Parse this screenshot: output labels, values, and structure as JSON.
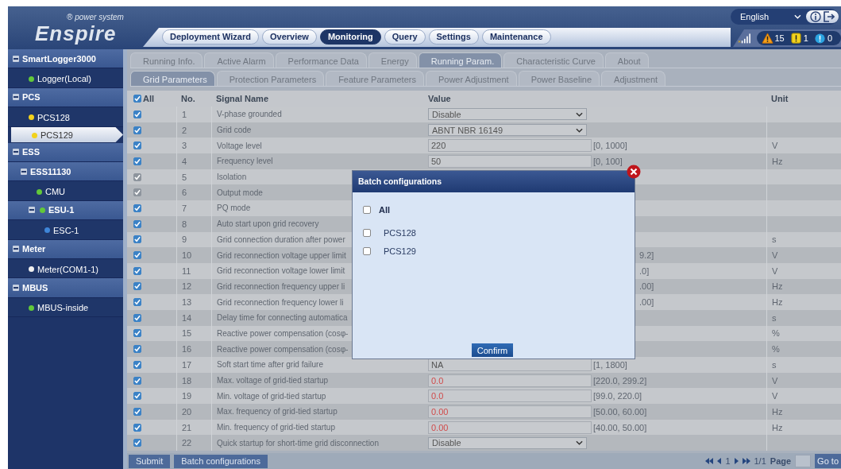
{
  "header": {
    "logo": "Enspire",
    "logo_tagline": "® power system",
    "language": "English",
    "nav": [
      {
        "label": "Deployment Wizard",
        "selected": false
      },
      {
        "label": "Overview",
        "selected": false
      },
      {
        "label": "Monitoring",
        "selected": true
      },
      {
        "label": "Query",
        "selected": false
      },
      {
        "label": "Settings",
        "selected": false
      },
      {
        "label": "Maintenance",
        "selected": false
      }
    ],
    "alarms": [
      {
        "kind": "major",
        "count": "15"
      },
      {
        "kind": "minor",
        "count": "1"
      },
      {
        "kind": "warning",
        "count": "0"
      }
    ]
  },
  "sidebar": {
    "items": [
      {
        "label": "SmartLogger3000",
        "expanded": true,
        "children": [
          {
            "label": "Logger(Local)",
            "color": "#62c83a",
            "selected": false
          }
        ]
      },
      {
        "label": "PCS",
        "expanded": true,
        "children": [
          {
            "label": "PCS128",
            "color": "#f2d21c",
            "selected": false
          },
          {
            "label": "PCS129",
            "color": "#f2d21c",
            "selected": true
          }
        ]
      },
      {
        "label": "ESS",
        "expanded": true,
        "children": [
          {
            "label": "ESS11130",
            "expanded": true,
            "children": [
              {
                "label": "CMU",
                "color": "#62c83a",
                "selected": false
              },
              {
                "label": "ESU-1",
                "color": "#62c83a",
                "expanded": true,
                "children": [
                  {
                    "label": "ESC-1",
                    "color": "#3f86d8",
                    "selected": false
                  }
                ]
              }
            ]
          }
        ]
      },
      {
        "label": "Meter",
        "expanded": true,
        "children": [
          {
            "label": "Meter(COM1-1)",
            "color": "#f0f0f0",
            "selected": false
          }
        ]
      },
      {
        "label": "MBUS",
        "expanded": true,
        "children": [
          {
            "label": "MBUS-inside",
            "color": "#62c83a",
            "selected": false
          }
        ]
      }
    ]
  },
  "tabs": [
    {
      "label": "Running Info.",
      "selected": false
    },
    {
      "label": "Active Alarm",
      "selected": false
    },
    {
      "label": "Performance Data",
      "selected": false
    },
    {
      "label": "Energy",
      "selected": false
    },
    {
      "label": "Running Param.",
      "selected": true
    },
    {
      "label": "Characteristic Curve",
      "selected": false
    },
    {
      "label": "About",
      "selected": false
    }
  ],
  "subtabs": [
    {
      "label": "Grid Parameters",
      "selected": true
    },
    {
      "label": "Protection Parameters",
      "selected": false
    },
    {
      "label": "Feature Parameters",
      "selected": false
    },
    {
      "label": "Power Adjustment",
      "selected": false
    },
    {
      "label": "Power Baseline",
      "selected": false
    },
    {
      "label": "Adjustment",
      "selected": false
    }
  ],
  "table": {
    "all_label": "All",
    "all_checked": true,
    "columns": [
      "No.",
      "Signal Name",
      "Value",
      "Unit"
    ],
    "rows": [
      {
        "no": "1",
        "name": "V-phase grounded",
        "checked": true,
        "disabled": false,
        "kind": "select",
        "value": "Disable"
      },
      {
        "no": "2",
        "name": "Grid code",
        "checked": true,
        "disabled": false,
        "kind": "select",
        "value": "ABNT NBR 16149"
      },
      {
        "no": "3",
        "name": "Voltage level",
        "checked": true,
        "disabled": false,
        "kind": "input",
        "value": "220",
        "range": "[0, 1000]",
        "unit": "V"
      },
      {
        "no": "4",
        "name": "Frequency level",
        "checked": true,
        "disabled": false,
        "kind": "input",
        "value": "50",
        "range": "[0, 100]",
        "unit": "Hz"
      },
      {
        "no": "5",
        "name": "Isolation",
        "checked": true,
        "disabled": true,
        "kind": "covered"
      },
      {
        "no": "6",
        "name": "Output mode",
        "checked": true,
        "disabled": true,
        "kind": "covered"
      },
      {
        "no": "7",
        "name": "PQ mode",
        "checked": true,
        "disabled": false,
        "kind": "covered"
      },
      {
        "no": "8",
        "name": "Auto start upon grid recovery",
        "checked": true,
        "disabled": false,
        "kind": "covered"
      },
      {
        "no": "9",
        "name": "Grid connection duration after power",
        "checked": true,
        "disabled": false,
        "kind": "covered",
        "unit": "s"
      },
      {
        "no": "10",
        "name": "Grid reconnection voltage upper limit",
        "checked": true,
        "disabled": false,
        "kind": "covered",
        "range": "9.2]",
        "unit": "V"
      },
      {
        "no": "11",
        "name": "Grid reconnection voltage lower limit",
        "checked": true,
        "disabled": false,
        "kind": "covered",
        "range": ".0]",
        "unit": "V"
      },
      {
        "no": "12",
        "name": "Grid reconnection frequency upper li",
        "checked": true,
        "disabled": false,
        "kind": "covered",
        "range": ".00]",
        "unit": "Hz"
      },
      {
        "no": "13",
        "name": "Grid reconnection frequency lower li",
        "checked": true,
        "disabled": false,
        "kind": "covered",
        "range": ".00]",
        "unit": "Hz"
      },
      {
        "no": "14",
        "name": "Delay time for connecting automatica",
        "checked": true,
        "disabled": false,
        "kind": "covered",
        "unit": "s"
      },
      {
        "no": "15",
        "name": "Reactive power compensation (cosφ-",
        "checked": true,
        "disabled": false,
        "kind": "covered",
        "unit": "%"
      },
      {
        "no": "16",
        "name": "Reactive power compensation (cosφ-",
        "checked": true,
        "disabled": false,
        "kind": "covered",
        "unit": "%"
      },
      {
        "no": "17",
        "name": "Soft start time after grid failure",
        "checked": true,
        "disabled": false,
        "kind": "input",
        "value": "NA",
        "range": "[1, 1800]",
        "unit": "s",
        "invalid": false
      },
      {
        "no": "18",
        "name": "Max. voltage of grid-tied startup",
        "checked": true,
        "disabled": false,
        "kind": "input",
        "value": "0.0",
        "range": "[220.0, 299.2]",
        "unit": "V",
        "invalid": true
      },
      {
        "no": "19",
        "name": "Min. voltage of grid-tied startup",
        "checked": true,
        "disabled": false,
        "kind": "input",
        "value": "0.0",
        "range": "[99.0, 220.0]",
        "unit": "V",
        "invalid": true
      },
      {
        "no": "20",
        "name": "Max. frequency of grid-tied startup",
        "checked": true,
        "disabled": false,
        "kind": "input",
        "value": "0.00",
        "range": "[50.00, 60.00]",
        "unit": "Hz",
        "invalid": true
      },
      {
        "no": "21",
        "name": "Min. frequency of grid-tied startup",
        "checked": true,
        "disabled": false,
        "kind": "input",
        "value": "0.00",
        "range": "[40.00, 50.00]",
        "unit": "Hz",
        "invalid": true
      },
      {
        "no": "22",
        "name": "Quick startup for short-time grid disconnection",
        "checked": true,
        "disabled": false,
        "kind": "select",
        "value": "Disable"
      }
    ]
  },
  "footer": {
    "buttons": [
      "Submit",
      "Batch configurations"
    ],
    "page_number": "1",
    "page_count": "1/1",
    "page_label": "Page",
    "goto": "Go to"
  },
  "dialog": {
    "title": "Batch configurations",
    "all_label": "All",
    "all_checked": false,
    "options": [
      {
        "label": "PCS128",
        "checked": false
      },
      {
        "label": "PCS129",
        "checked": false
      }
    ],
    "confirm": "Confirm"
  }
}
